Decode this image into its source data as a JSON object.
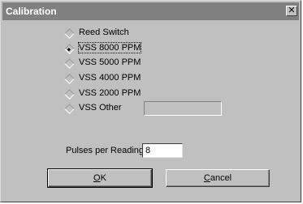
{
  "window": {
    "title": "Calibration",
    "close_glyph": "✕"
  },
  "options": [
    {
      "label": "Reed Switch",
      "selected": false
    },
    {
      "label": "VSS 8000 PPM",
      "selected": true
    },
    {
      "label": "VSS 5000 PPM",
      "selected": false
    },
    {
      "label": "VSS 4000 PPM",
      "selected": false
    },
    {
      "label": "VSS 2000 PPM",
      "selected": false
    },
    {
      "label": "VSS Other",
      "selected": false
    }
  ],
  "other_value": "",
  "pulses": {
    "label": "Pulses per Reading:",
    "value": "8"
  },
  "buttons": {
    "ok_mnemonic": "O",
    "ok_rest": "K",
    "cancel_mnemonic": "C",
    "cancel_rest": "ancel"
  }
}
